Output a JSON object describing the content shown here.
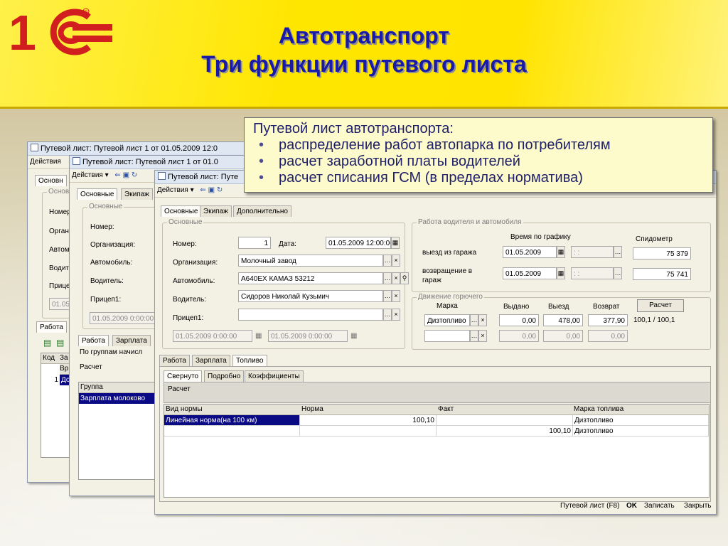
{
  "slide": {
    "title_line1": "Автотранспорт",
    "title_line2": "Три функции путевого листа",
    "logo_text": "1С",
    "callout": {
      "heading": "Путевой лист автотранспорта:",
      "bullets": [
        "распределение работ автопарка по потребителям",
        "расчет заработной платы водителей",
        "расчет списания ГСМ (в пределах норматива)"
      ]
    }
  },
  "back_window": {
    "title": "Путевой лист: Путевой лист 1 от 01.05.2009 12:0",
    "menu": "Действия",
    "tab": "Основн",
    "group": "Основ",
    "labels": [
      "Номер",
      "Органи",
      "Автом",
      "Водит",
      "Прицеп"
    ],
    "date": "01.05",
    "tab_work": "Работа",
    "col_code": "Код",
    "col_za": "За",
    "col_vr": "Вр",
    "row_num": "1",
    "row_do": "До"
  },
  "mid_window": {
    "title": "Путевой лист: Путевой лист 1 от 01.0",
    "menu": "Действия",
    "tabs": [
      "Основные",
      "Экипаж"
    ],
    "group": "Основные",
    "labels": [
      "Номер:",
      "Организация:",
      "Автомобиль:",
      "Водитель:",
      "Прицеп1:"
    ],
    "date": "01.05.2009 0:00:00",
    "bottom_tabs": [
      "Работа",
      "Зарплата"
    ],
    "group_by": "По группам начисл",
    "calc": "Расчет",
    "col_group": "Группа",
    "row_group": "Зарплата молоково"
  },
  "front_window": {
    "title": "Путевой лист: Путе",
    "menu": "Действия",
    "tabs": [
      "Основные",
      "Экипаж",
      "Дополнительно"
    ],
    "group_main": "Основные",
    "number_label": "Номер:",
    "number_value": "1",
    "date_label": "Дата:",
    "date_value": "01.05.2009 12:00:00",
    "org_label": "Организация:",
    "org_value": "Молочный завод",
    "car_label": "Автомобиль:",
    "car_value": "А640ЕХ КАМАЗ 53212",
    "driver_label": "Водитель:",
    "driver_value": "Сидоров Николай Кузьмич",
    "trailer_label": "Прицеп1:",
    "trailer_value": "",
    "trailer_date1": "01.05.2009 0:00:00",
    "trailer_date2": "01.05.2009 0:00:00",
    "group_work": "Работа водителя и автомобиля",
    "sched_header": "Время по графику",
    "odo_header": "Спидометр",
    "depart_label": "выезд из гаража",
    "depart_date": "01.05.2009",
    "depart_time": ": :",
    "depart_odo": "75 379",
    "return_label_1": "возвращение в",
    "return_label_2": "гараж",
    "return_date": "01.05.2009",
    "return_time": ": :",
    "return_odo": "75 741",
    "group_fuel": "Движение горючего",
    "fuel_headers": [
      "Марка",
      "Выдано",
      "Выезд",
      "Возврат"
    ],
    "calc_button": "Расчет",
    "fuel_row1": [
      "Дизтопливо",
      "0,00",
      "478,00",
      "377,90"
    ],
    "fuel_row1_ratio": "100,1 / 100,1",
    "fuel_row2": [
      "",
      "0,00",
      "0,00",
      "0,00"
    ],
    "bottom_tabs": [
      "Работа",
      "Зарплата",
      "Топливо"
    ],
    "sub_tabs": [
      "Свернуто",
      "Подробно",
      "Коэффициенты"
    ],
    "calc_label": "Расчет",
    "table_headers": [
      "Вид нормы",
      "Норма",
      "Факт",
      "Марка топлива"
    ],
    "table_rows": [
      [
        "Линейная норма(на 100 км)",
        "100,10",
        "",
        "Дизтопливо"
      ],
      [
        "",
        "",
        "100,10",
        "Дизтопливо"
      ]
    ],
    "footer": [
      "Путевой лист (F8)",
      "OK",
      "Записать",
      "Закрыть"
    ]
  }
}
